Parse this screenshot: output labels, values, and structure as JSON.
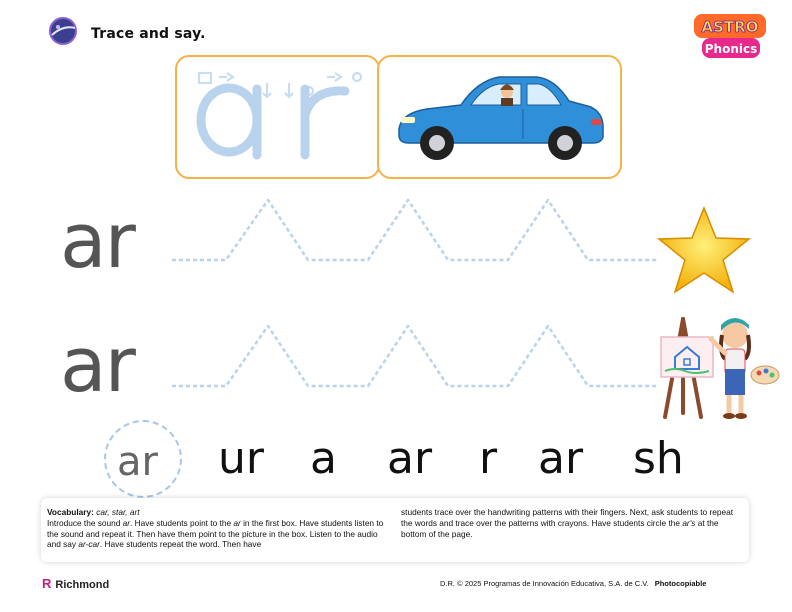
{
  "header": {
    "instruction": "Trace and say.",
    "brand_line1": "ASTRO",
    "brand_line2": "Phonics"
  },
  "trace_box": {
    "trace_letters": "ar"
  },
  "rows": [
    {
      "label": "ar",
      "picture": "star-icon"
    },
    {
      "label": "ar",
      "picture": "painter-girl"
    }
  ],
  "choices": [
    "ar",
    "ur",
    "a",
    "ar",
    "r",
    "ar",
    "sh"
  ],
  "notes": {
    "vocab_label": "Vocabulary:",
    "vocab_words": "car, star, art",
    "left_a": "Introduce the sound ",
    "left_b": "ar",
    "left_c": ". Have students point to the ",
    "left_d": "ar",
    "left_e": " in the first box. Have students listen to the sound and repeat it. Then have them point to the picture in the box. Listen to the audio and say ",
    "left_f": "ar-car",
    "left_g": ". Have students repeat the word. Then have",
    "right_a": "students trace over the handwriting patterns with their fingers. Next, ask students to repeat the words and trace over the patterns with crayons. Have students circle the ",
    "right_b": "ar's",
    "right_c": " at the bottom of the page."
  },
  "footer": {
    "logo_mark": "R",
    "logo_text": "Richmond",
    "copyright": "D.R. © 2025 Programas de Innovación Educativa, S.A. de C.V.",
    "photocopiable": "Photocopiable"
  },
  "colors": {
    "panel_border": "#f5b247",
    "trace_dash": "#a8c7e6",
    "car_blue": "#2f8fd8",
    "star_yellow": "#f7c21b"
  }
}
